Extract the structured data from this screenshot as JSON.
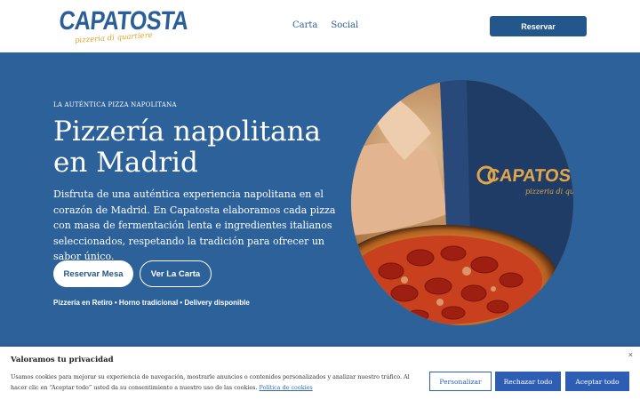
{
  "header": {
    "logo_text": "CAPATOSTA",
    "logo_subtext": "pizzeria di quartiere",
    "nav": [
      "Carta",
      "Social"
    ],
    "cta_label": "Reservar"
  },
  "hero": {
    "eyebrow": "LA AUTÉNTICA PIZZA NAPOLITANA",
    "title": "Pizzería napolitana en Madrid",
    "description": "Disfruta de una auténtica experiencia napolitana en el corazón de Madrid. En Capatosta elaboramos cada pizza con masa de fermentación lenta e ingredientes italianos seleccionados, respetando la tradición para ofrecer un sabor único.",
    "primary_button": "Reservar Mesa",
    "secondary_button": "Ver La Carta",
    "features": "Pizzería en Retiro • Horno tradicional • Delivery disponible",
    "image": {
      "apron_logo_text": "CAPATOSTA",
      "apron_logo_subtext": "pizzeria di quartiere"
    }
  },
  "cookie_banner": {
    "title": "Valoramos tu privacidad",
    "text": "Usamos cookies para mejorar su experiencia de navegación, mostrarle anuncios o contenidos personalizados y analizar nuestro tráfico. Al hacer clic en “Aceptar todo” usted da su consentimiento a nuestro uso de las cookies.",
    "policy_link": "Política de cookies",
    "close_glyph": "×",
    "buttons": {
      "customize": "Personalizar",
      "reject": "Rechazar todo",
      "accept": "Aceptar todo"
    }
  },
  "colors": {
    "brand_blue": "#2d619a",
    "button_blue": "#23578c",
    "logo_gold": "#e0a52c",
    "cookie_blue": "#2d5eb4"
  }
}
